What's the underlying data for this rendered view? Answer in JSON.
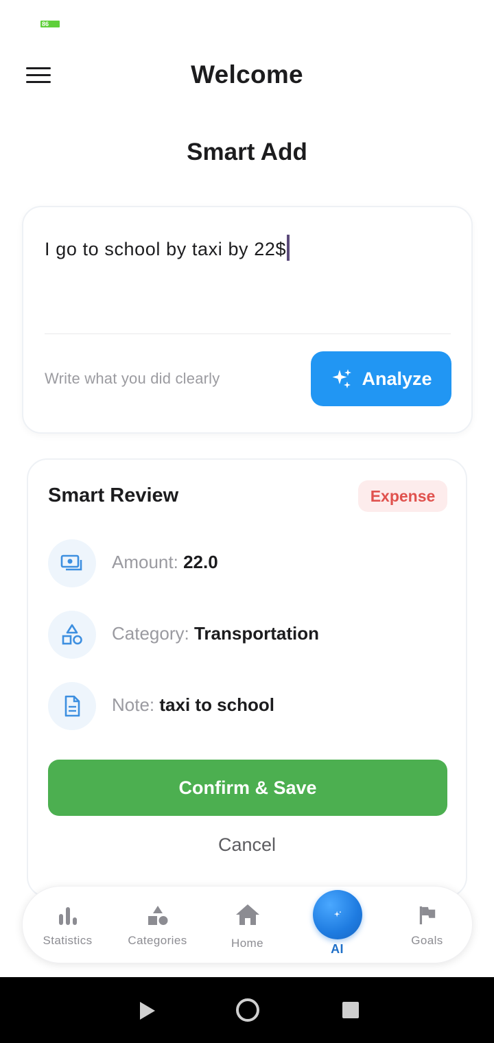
{
  "status_bar": {
    "battery": "86"
  },
  "app_bar": {
    "title": "Welcome",
    "menu_icon": "hamburger-menu-icon"
  },
  "page": {
    "title": "Smart Add"
  },
  "input_card": {
    "text": "I go to school by taxi by 22$",
    "hint": "Write what you did clearly",
    "analyze_label": "Analyze",
    "analyze_icon": "sparkles-icon"
  },
  "review": {
    "title": "Smart Review",
    "badge": "Expense",
    "rows": [
      {
        "label": "Amount:",
        "value": "22.0",
        "icon": "money-icon"
      },
      {
        "label": "Category:",
        "value": "Transportation",
        "icon": "shapes-icon"
      },
      {
        "label": "Note:",
        "value": "taxi to school",
        "icon": "document-icon"
      }
    ],
    "confirm_label": "Confirm & Save",
    "cancel_label": "Cancel"
  },
  "bottom_nav": {
    "items": [
      {
        "label": "Statistics",
        "icon": "bar-chart-icon"
      },
      {
        "label": "Categories",
        "icon": "shapes-icon"
      },
      {
        "label": "Home",
        "icon": "home-icon"
      },
      {
        "label": "AI",
        "icon": "sparkles-icon",
        "active": true
      },
      {
        "label": "Goals",
        "icon": "flag-icon"
      }
    ]
  },
  "colors": {
    "primary": "#2196f3",
    "confirm": "#4caf50",
    "expense_text": "#e0524e",
    "expense_bg": "#fdecec"
  }
}
